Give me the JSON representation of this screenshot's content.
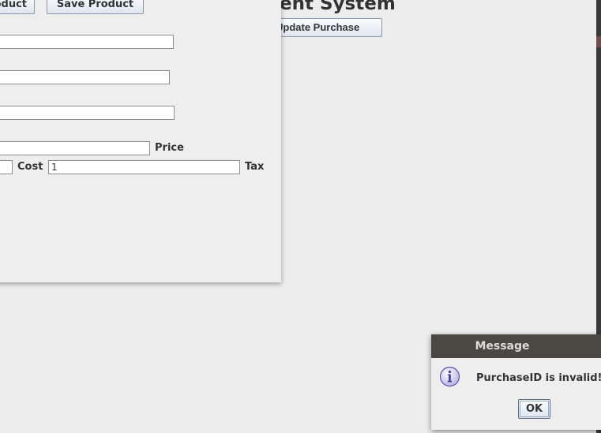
{
  "main_window": {
    "title": "ent System",
    "update_purchase_label": "Update Purchase"
  },
  "product_window": {
    "buttons": {
      "add_product_label": "oduct",
      "save_product_label": "Save Product"
    },
    "fields": {
      "field1_value": "",
      "field2_value": "",
      "field3_value": "",
      "field4_value": "",
      "field5_value": "",
      "cost_value": "1"
    },
    "labels": {
      "price": "Price",
      "cost": "Cost",
      "tax": "Tax"
    }
  },
  "dialog": {
    "title": "Message",
    "icon": "info-icon",
    "message": "PurchaseID is invalid!",
    "ok_label": "OK"
  },
  "colors": {
    "dialog_titlebar": "#4b4844",
    "background": "#ededed",
    "button_border": "#8a98aa"
  }
}
